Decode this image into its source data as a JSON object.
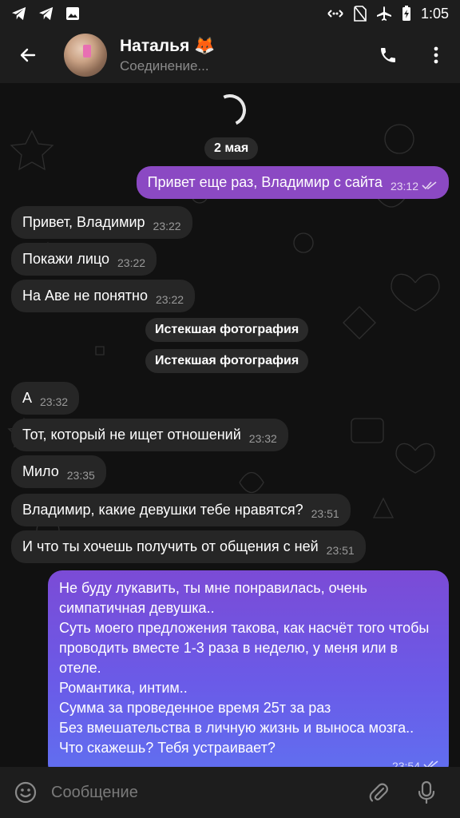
{
  "status_bar": {
    "time": "1:05"
  },
  "header": {
    "name": "Наталья 🦊",
    "status": "Соединение..."
  },
  "chat": {
    "date_label": "2 мая",
    "messages": [
      {
        "text": "Привет еще раз, Владимир с сайта",
        "time": "23:12"
      },
      {
        "text": "Привет, Владимир",
        "time": "23:22"
      },
      {
        "text": "Покажи лицо",
        "time": "23:22"
      },
      {
        "text": "На Аве не понятно",
        "time": "23:22"
      },
      {
        "text": "Истекшая фотография"
      },
      {
        "text": "Истекшая фотография"
      },
      {
        "text": "А",
        "time": "23:32"
      },
      {
        "text": "Тот, который не ищет отношений",
        "time": "23:32"
      },
      {
        "text": "Мило",
        "time": "23:35"
      },
      {
        "text": "Владимир, какие девушки тебе нравятся?",
        "time": "23:51"
      },
      {
        "text": "И что ты хочешь получить от общения с ней",
        "time": "23:51"
      },
      {
        "text": "Не буду лукавить, ты мне понравилась, очень симпатичная девушка..\nСуть моего предложения такова, как насчёт того чтобы проводить вместе 1-3 раза в неделю, у меня или в отеле.\nРомантика, интим..\nСумма за проведенное время 25т за раз\nБез вмешательства в личную жизнь и выноса мозга..\nЧто скажешь? Тебя устраивает?",
        "time": "23:54"
      }
    ]
  },
  "composer": {
    "placeholder": "Сообщение"
  },
  "colors": {
    "outgoing": "#8b49c3",
    "incoming": "#262626",
    "gradient_start": "#7b4bd6",
    "gradient_end": "#6070f0"
  }
}
